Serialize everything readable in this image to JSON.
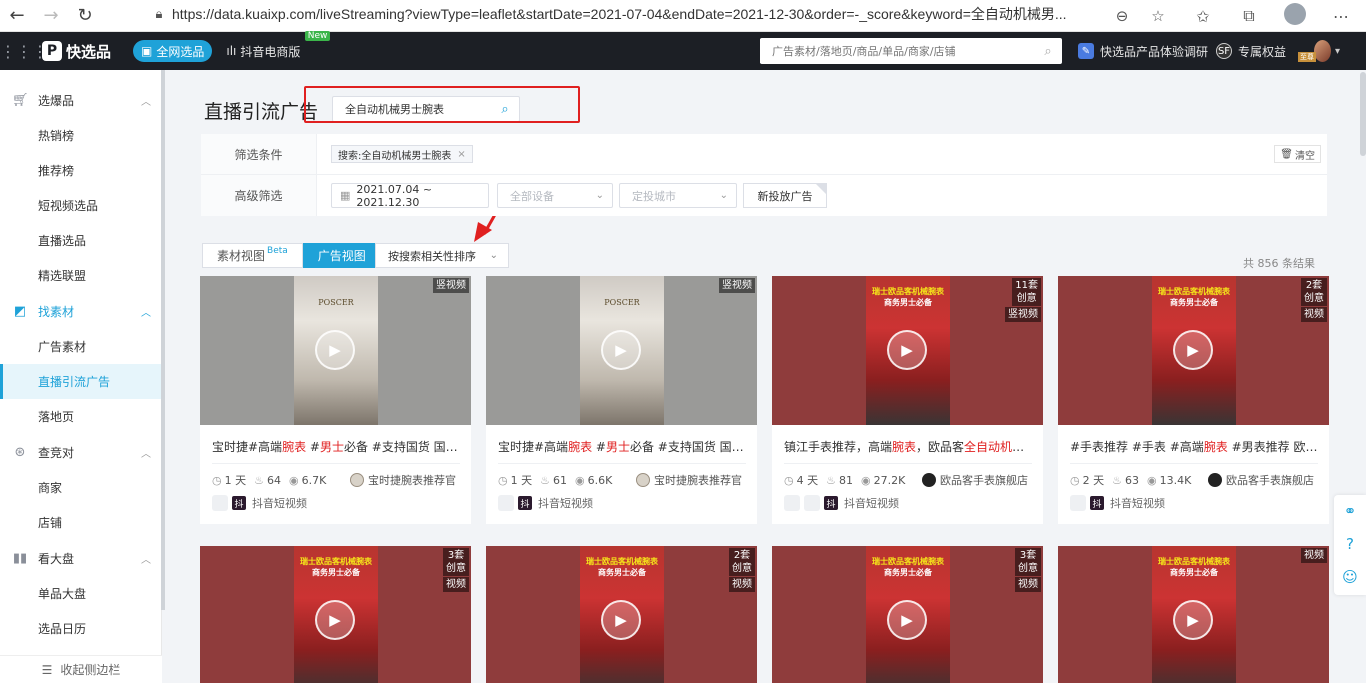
{
  "browser": {
    "url_prefix": "https://",
    "url": "data.kuaixp.com/liveStreaming?viewType=leaflet&startDate=2021-07-04&endDate=2021-12-30&order=-_score&keyword=全自动机械男..."
  },
  "header": {
    "logo_text": "快选品",
    "all_network_label": "全网选品",
    "douyin_tab_label": "抖音电商版",
    "new_badge": "New",
    "search_placeholder": "广告素材/落地页/商品/单品/商家/店铺",
    "survey_label": "快选品产品体验调研",
    "rights_label": "专属权益",
    "user_tag": "至尊"
  },
  "sidebar": {
    "groups": [
      {
        "label": "选爆品",
        "items": [
          "热销榜",
          "推荐榜",
          "短视频选品",
          "直播选品",
          "精选联盟"
        ]
      },
      {
        "label": "找素材",
        "items": [
          "广告素材",
          "直播引流广告",
          "落地页"
        ]
      },
      {
        "label": "查竞对",
        "items": [
          "商家",
          "店铺"
        ]
      },
      {
        "label": "看大盘",
        "items": [
          "单品大盘",
          "选品日历"
        ]
      }
    ],
    "footer_label": "收起侧边栏"
  },
  "main": {
    "page_title": "直播引流广告",
    "keyword": "全自动机械男士腕表",
    "filter_label_1": "筛选条件",
    "filter_chip": "搜索:全自动机械男士腕表",
    "clear_label": "清空",
    "filter_label_2": "高级筛选",
    "date_range": "2021.07.04 ~ 2021.12.30",
    "device_placeholder": "全部设备",
    "city_placeholder": "定投城市",
    "new_ad_label": "新投放广告",
    "tab_material": "素材视图",
    "tab_beta": "Beta",
    "tab_ad": "广告视图",
    "sort_label": "按搜索相关性排序",
    "result_count": "共 856 条结果"
  },
  "cards": [
    {
      "badges": [
        "竖视频"
      ],
      "title_parts": [
        "宝时捷#高端",
        "腕表",
        " #",
        "男士",
        "必备 #支持国货 国货之光"
      ],
      "days": "1 天",
      "heat": "64",
      "views": "6.7K",
      "shop": "宝时捷腕表推荐官",
      "platform": "抖音短视频",
      "brand": "POSCER"
    },
    {
      "badges": [
        "竖视频"
      ],
      "title_parts": [
        "宝时捷#高端",
        "腕表",
        " #",
        "男士",
        "必备 #支持国货 国货之光"
      ],
      "days": "1 天",
      "heat": "61",
      "views": "6.6K",
      "shop": "宝时捷腕表推荐官",
      "platform": "抖音短视频",
      "brand": "POSCER"
    },
    {
      "badges": [
        "11套\n创意",
        "竖视频"
      ],
      "title_parts": [
        "镇江手表推荐，高端",
        "腕表",
        "，欧品客",
        "全自动机械腕",
        "表"
      ],
      "days": "4 天",
      "heat": "81",
      "views": "27.2K",
      "shop": "欧品客手表旗舰店",
      "platform": "抖音短视频",
      "overlay1": "瑞士欧品客机械腕表",
      "overlay2": "商务男士必备"
    },
    {
      "badges": [
        "2套\n创意",
        "视频"
      ],
      "title_parts": [
        "#手表推荐 #手表 #高端",
        "腕表",
        " #男表推荐 欧品客",
        "",
        ""
      ],
      "days": "2 天",
      "heat": "63",
      "views": "13.4K",
      "shop": "欧品客手表旗舰店",
      "platform": "抖音短视频",
      "overlay1": "瑞士欧品客机械腕表",
      "overlay2": "商务男士必备"
    },
    {
      "badges": [
        "3套\n创意",
        "视频"
      ],
      "overlay1": "瑞士欧品客机械腕表",
      "overlay2": "商务男士必备"
    },
    {
      "badges": [
        "2套\n创意",
        "视频"
      ],
      "overlay1": "瑞士欧品客机械腕表",
      "overlay2": "商务男士必备"
    },
    {
      "badges": [
        "3套\n创意",
        "视频"
      ],
      "overlay1": "瑞士欧品客机械腕表",
      "overlay2": "商务男士必备"
    },
    {
      "badges": [
        "视频"
      ],
      "overlay1": "瑞士欧品客机械腕表",
      "overlay2": "商务男士必备"
    }
  ],
  "colors": {
    "accent": "#1fa2d8",
    "highlight": "#e02020",
    "header_bg": "#1c1f25"
  }
}
